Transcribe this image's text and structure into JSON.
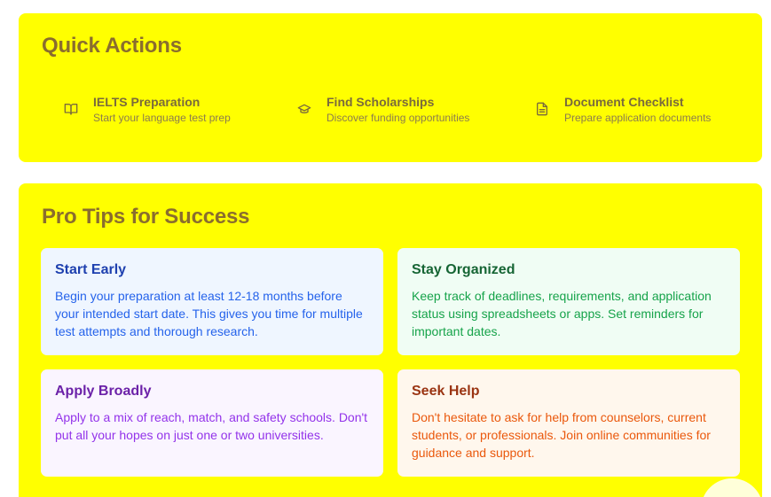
{
  "quick_actions": {
    "title": "Quick Actions",
    "items": [
      {
        "icon": "book-open-icon",
        "title": "IELTS Preparation",
        "subtitle": "Start your language test prep"
      },
      {
        "icon": "graduation-cap-icon",
        "title": "Find Scholarships",
        "subtitle": "Discover funding opportunities"
      },
      {
        "icon": "file-text-icon",
        "title": "Document Checklist",
        "subtitle": "Prepare application documents"
      }
    ],
    "colors": {
      "card_bg": "#ffff00",
      "title": "#8a6d2e"
    }
  },
  "pro_tips": {
    "title": "Pro Tips for Success",
    "tips": [
      {
        "title": "Start Early",
        "body": "Begin your preparation at least 12-18 months before your intended start date. This gives you time for multiple test attempts and thorough research.",
        "color": "blue"
      },
      {
        "title": "Stay Organized",
        "body": "Keep track of deadlines, requirements, and application status using spreadsheets or apps. Set reminders for important dates.",
        "color": "green"
      },
      {
        "title": "Apply Broadly",
        "body": "Apply to a mix of reach, match, and safety schools. Don't put all your hopes on just one or two universities.",
        "color": "purple"
      },
      {
        "title": "Seek Help",
        "body": "Don't hesitate to ask for help from counselors, current students, or professionals. Join online communities for guidance and support.",
        "color": "orange"
      }
    ]
  }
}
